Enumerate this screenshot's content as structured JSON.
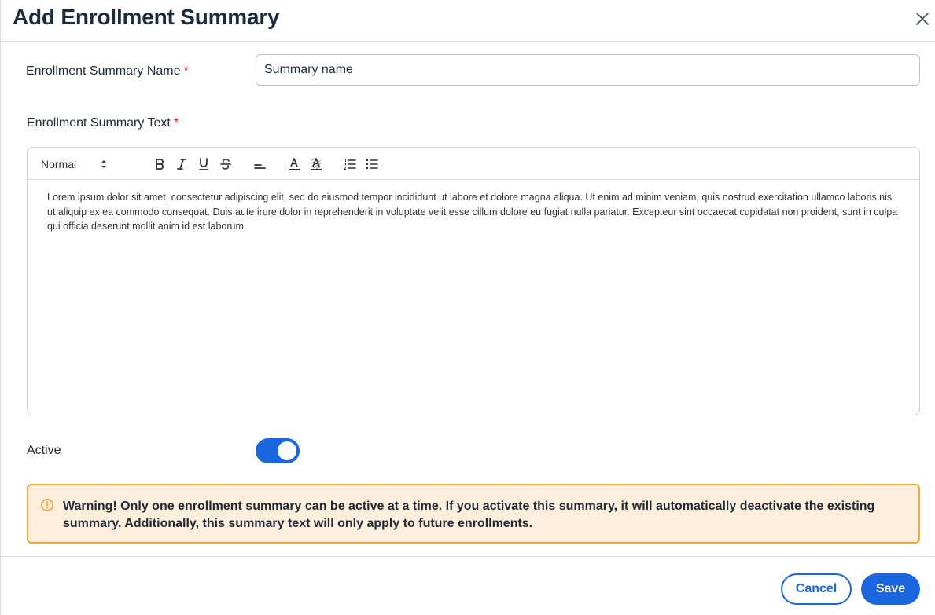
{
  "dialog": {
    "title": "Add Enrollment Summary"
  },
  "form": {
    "name_label": "Enrollment Summary Name",
    "name_required": "*",
    "name_value": "Summary name",
    "text_label": "Enrollment Summary Text",
    "text_required": "*",
    "editor": {
      "format_select": "Normal",
      "toolbar_icons": [
        "bold-icon",
        "italic-icon",
        "underline-icon",
        "strikethrough-icon",
        "align-icon",
        "text-color-icon",
        "background-color-icon",
        "ordered-list-icon",
        "bullet-list-icon"
      ],
      "content": "Lorem ipsum dolor sit amet, consectetur adipiscing elit, sed do eiusmod tempor incididunt ut labore et dolore magna aliqua. Ut enim ad minim veniam, quis nostrud exercitation ullamco laboris nisi ut aliquip ex ea commodo consequat. Duis aute irure dolor in reprehenderit in voluptate velit esse cillum dolore eu fugiat nulla pariatur. Excepteur sint occaecat cupidatat non proident, sunt in culpa qui officia deserunt mollit anim id est laborum."
    },
    "active_label": "Active",
    "active": true
  },
  "warning": {
    "text": "Warning! Only one enrollment summary can be active at a time. If you activate this summary, it will automatically deactivate the existing summary. Additionally, this summary text will only apply to future enrollments."
  },
  "footer": {
    "cancel_label": "Cancel",
    "save_label": "Save"
  },
  "colors": {
    "primary": "#1a66e0",
    "warning_bg": "#feefdd",
    "warning_border": "#f4a53b",
    "required": "#d9272e"
  }
}
